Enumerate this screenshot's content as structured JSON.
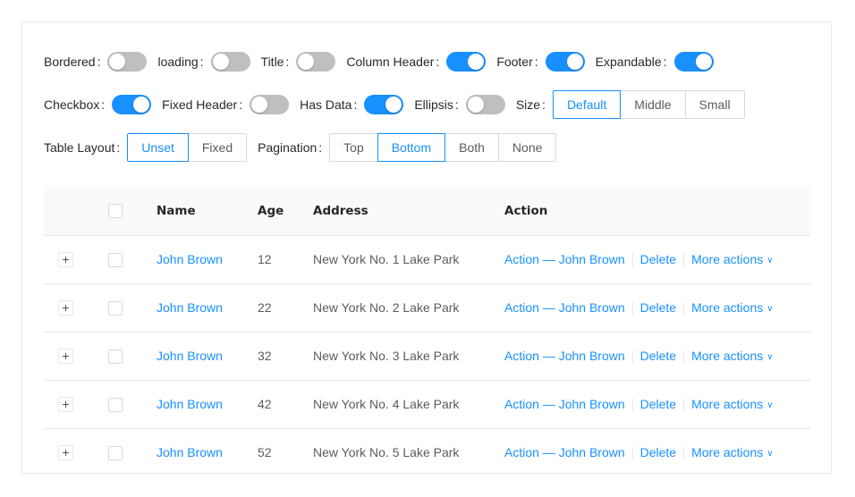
{
  "controls": {
    "row1": [
      {
        "label": "Bordered",
        "on": false
      },
      {
        "label": "loading",
        "on": false
      },
      {
        "label": "Title",
        "on": false
      },
      {
        "label": "Column Header",
        "on": true
      },
      {
        "label": "Footer",
        "on": true
      },
      {
        "label": "Expandable",
        "on": true
      }
    ],
    "row2": [
      {
        "label": "Checkbox",
        "on": true
      },
      {
        "label": "Fixed Header",
        "on": false
      },
      {
        "label": "Has Data",
        "on": true
      },
      {
        "label": "Ellipsis",
        "on": false
      }
    ],
    "size": {
      "label": "Size",
      "options": [
        "Default",
        "Middle",
        "Small"
      ],
      "selected": "Default"
    },
    "table_layout": {
      "label": "Table Layout",
      "options": [
        "Unset",
        "Fixed"
      ],
      "selected": "Unset"
    },
    "pagination": {
      "label": "Pagination",
      "options": [
        "Top",
        "Bottom",
        "Both",
        "None"
      ],
      "selected": "Bottom"
    },
    "colon": ":"
  },
  "table": {
    "columns": {
      "name": "Name",
      "age": "Age",
      "address": "Address",
      "action": "Action"
    },
    "rows": [
      {
        "name": "John Brown",
        "age": "12",
        "address": "New York No. 1 Lake Park"
      },
      {
        "name": "John Brown",
        "age": "22",
        "address": "New York No. 2 Lake Park"
      },
      {
        "name": "John Brown",
        "age": "32",
        "address": "New York No. 3 Lake Park"
      },
      {
        "name": "John Brown",
        "age": "42",
        "address": "New York No. 4 Lake Park"
      },
      {
        "name": "John Brown",
        "age": "52",
        "address": "New York No. 5 Lake Park"
      }
    ],
    "action_label": "Action — John Brown",
    "delete_label": "Delete",
    "more_label": "More actions",
    "caret_glyph": "∨"
  },
  "colors": {
    "primary": "#1890ff",
    "switch_off": "#bfbfbf",
    "border": "#e8e8e8"
  }
}
